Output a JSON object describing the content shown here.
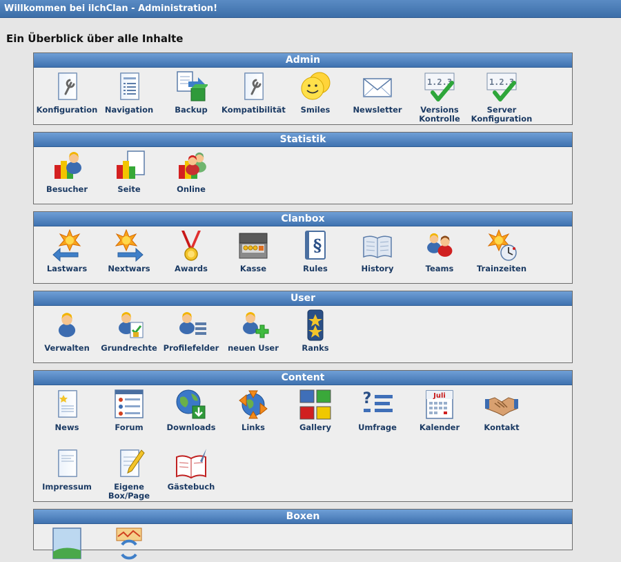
{
  "window": {
    "title": "Willkommen bei ilchClan - Administration!"
  },
  "page": {
    "title": "Ein Überblick über alle Inhalte"
  },
  "sections": [
    {
      "title": "Admin",
      "items": [
        {
          "label": "Konfiguration",
          "icon": "wrench-page-icon"
        },
        {
          "label": "Navigation",
          "icon": "list-page-icon"
        },
        {
          "label": "Backup",
          "icon": "backup-box-icon"
        },
        {
          "label": "Kompatibilität",
          "icon": "wrench-page-icon"
        },
        {
          "label": "Smiles",
          "icon": "smiley-icon"
        },
        {
          "label": "Newsletter",
          "icon": "envelope-icon"
        },
        {
          "label": "Versions\nKontrolle",
          "icon": "version-check-icon"
        },
        {
          "label": "Server\nKonfiguration",
          "icon": "version-check-icon"
        }
      ]
    },
    {
      "title": "Statistik",
      "items": [
        {
          "label": "Besucher",
          "icon": "bar-chart-user-icon"
        },
        {
          "label": "Seite",
          "icon": "bar-chart-page-icon"
        },
        {
          "label": "Online",
          "icon": "bar-chart-users-icon"
        }
      ]
    },
    {
      "title": "Clanbox",
      "items": [
        {
          "label": "Lastwars",
          "icon": "burst-arrow-left-icon"
        },
        {
          "label": "Nextwars",
          "icon": "burst-arrow-right-icon"
        },
        {
          "label": "Awards",
          "icon": "medal-icon"
        },
        {
          "label": "Kasse",
          "icon": "cash-box-icon"
        },
        {
          "label": "Rules",
          "icon": "paragraph-book-icon"
        },
        {
          "label": "History",
          "icon": "open-book-icon"
        },
        {
          "label": "Teams",
          "icon": "team-icon"
        },
        {
          "label": "Trainzeiten",
          "icon": "burst-clock-icon"
        }
      ]
    },
    {
      "title": "User",
      "items": [
        {
          "label": "Verwalten",
          "icon": "user-icon"
        },
        {
          "label": "Grundrechte",
          "icon": "user-rights-icon"
        },
        {
          "label": "Profilefelder",
          "icon": "user-fields-icon"
        },
        {
          "label": "neuen User",
          "icon": "user-add-icon"
        },
        {
          "label": "Ranks",
          "icon": "ranks-icon"
        }
      ]
    },
    {
      "title": "Content",
      "items": [
        {
          "label": "News",
          "icon": "news-page-icon"
        },
        {
          "label": "Forum",
          "icon": "forum-icon"
        },
        {
          "label": "Downloads",
          "icon": "globe-download-icon"
        },
        {
          "label": "Links",
          "icon": "links-globe-icon"
        },
        {
          "label": "Gallery",
          "icon": "gallery-icon"
        },
        {
          "label": "Umfrage",
          "icon": "poll-icon"
        },
        {
          "label": "Kalender",
          "icon": "calendar-icon"
        },
        {
          "label": "Kontakt",
          "icon": "handshake-icon"
        },
        {
          "label": "Impressum",
          "icon": "plain-page-icon"
        },
        {
          "label": "Eigene\nBox/Page",
          "icon": "page-pencil-icon"
        },
        {
          "label": "Gästebuch",
          "icon": "guestbook-icon"
        }
      ]
    },
    {
      "title": "Boxen",
      "items": [
        {
          "label": "",
          "icon": "landscape-page-icon"
        },
        {
          "label": "",
          "icon": "refresh-image-icon"
        }
      ]
    }
  ],
  "calendar": {
    "month": "Juli"
  },
  "colors": {
    "header": "#4f82bf",
    "label": "#1b3a63",
    "background": "#e6e6e6"
  }
}
